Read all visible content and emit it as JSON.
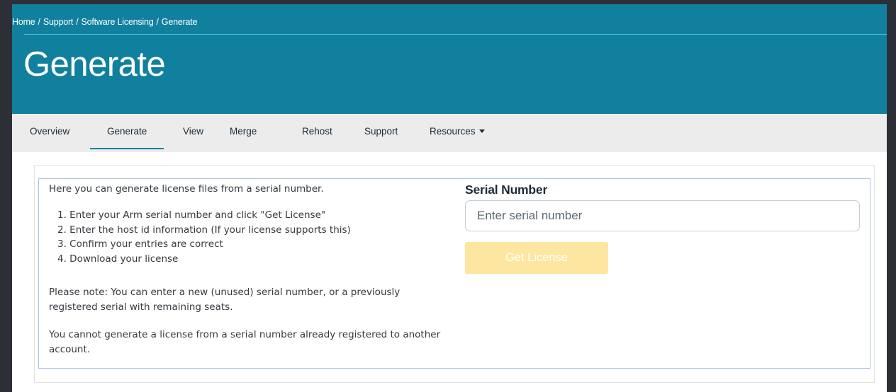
{
  "breadcrumb": {
    "items": [
      "Home",
      "Support",
      "Software Licensing",
      "Generate"
    ],
    "separator": "/"
  },
  "page": {
    "title": "Generate"
  },
  "subnav": {
    "items": [
      "Overview",
      "Generate",
      "View",
      "Merge",
      "Rehost",
      "Support",
      "Resources"
    ],
    "active": "Generate",
    "dropdown_icon": "caret-down-icon"
  },
  "content": {
    "intro": "Here you can generate license files from a serial number.",
    "steps": [
      "1. Enter your Arm serial number and click \"Get License\"",
      "2. Enter the host id information (If your license supports this)",
      "3. Confirm your entries are correct",
      "4. Download your license"
    ],
    "note_1": "Please note: You can enter a new (unused) serial number, or a previously registered serial with remaining seats.",
    "note_2": "You cannot generate a license from a serial number already registered to another account."
  },
  "form": {
    "label": "Serial Number",
    "placeholder": "Enter serial number",
    "value": "",
    "submit_label": "Get License",
    "submit_enabled": false
  },
  "colors": {
    "hero": "#11809f",
    "subnav": "#ececec",
    "button_disabled": "#fde6a0",
    "panel_border": "#a9c3ec"
  }
}
